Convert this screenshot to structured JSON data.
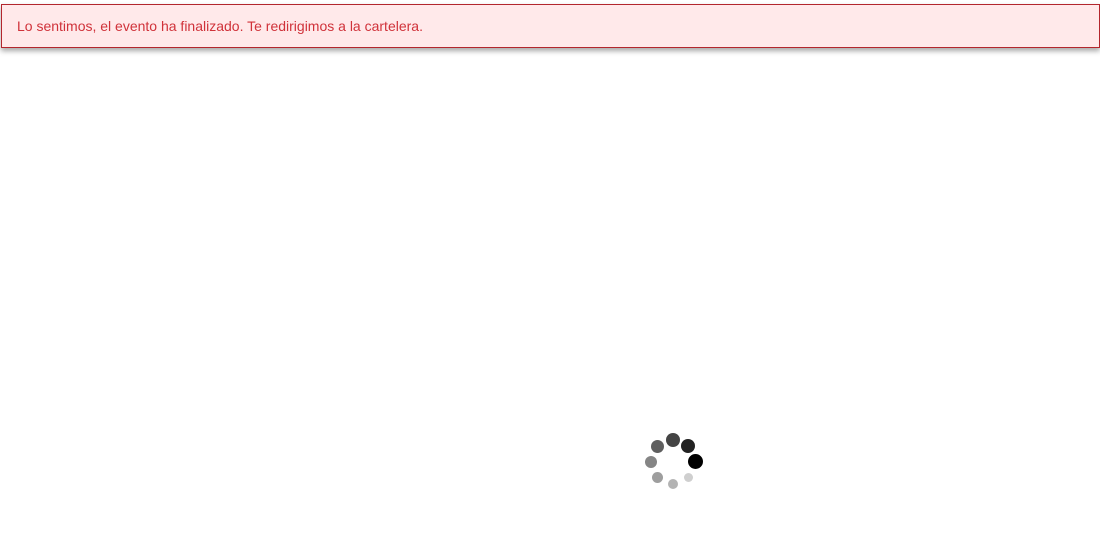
{
  "alert": {
    "message": "Lo sentimos, el evento ha finalizado. Te redirigimos a la cartelera.",
    "text_color": "#d0323a",
    "background_color": "#ffe9ea",
    "border_color": "#b3262d"
  },
  "loader": {
    "icon": "loading-spinner-icon",
    "dot_colors": [
      "#000000",
      "#222222",
      "#444444",
      "#5f5f5f",
      "#858585",
      "#9e9e9e",
      "#b3b3b3",
      "#cfcfcf"
    ]
  }
}
